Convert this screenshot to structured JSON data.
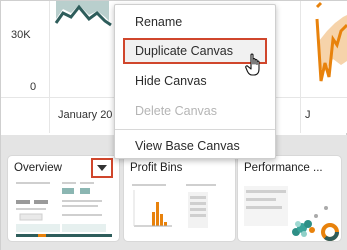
{
  "canvas": {
    "y_ticks": [
      "30K",
      "0"
    ],
    "x_ticks": [
      "January 20",
      "J"
    ],
    "colors": {
      "teal_line": "#2e5d5b",
      "teal_band": "#b9cfcd",
      "orange_line": "#e8820c",
      "orange_band": "#f6d3aa"
    }
  },
  "context_menu": {
    "items": [
      {
        "label": "Rename",
        "state": "normal"
      },
      {
        "label": "Duplicate Canvas",
        "state": "highlighted"
      },
      {
        "label": "Hide Canvas",
        "state": "normal"
      },
      {
        "label": "Delete Canvas",
        "state": "disabled"
      },
      {
        "label": "View Base Canvas",
        "state": "normal"
      }
    ]
  },
  "thumbnails": [
    {
      "title": "Overview",
      "menu_icon": "chevron-down-icon"
    },
    {
      "title": "Profit Bins"
    },
    {
      "title": "Performance ..."
    }
  ],
  "highlight_color": "#d0462c"
}
